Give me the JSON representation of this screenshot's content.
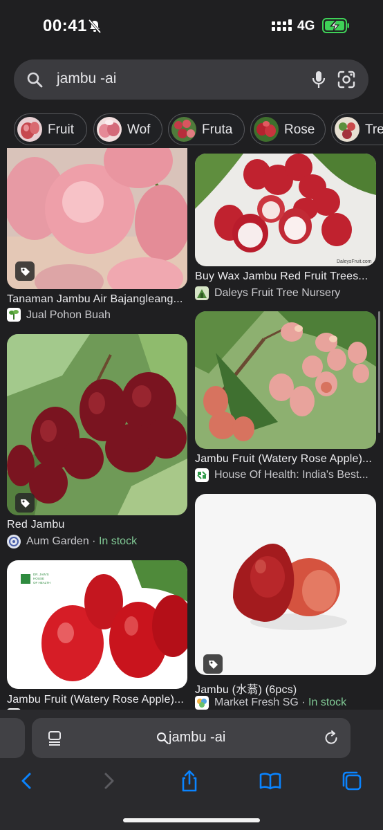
{
  "status": {
    "time": "00:41",
    "network": "4G",
    "battery_charging": true
  },
  "search": {
    "query": "jambu -ai"
  },
  "chips": [
    {
      "label": "Fruit"
    },
    {
      "label": "Wof"
    },
    {
      "label": "Fruta"
    },
    {
      "label": "Rose"
    },
    {
      "label": "Tre"
    }
  ],
  "results": [
    {
      "title": "Tanaman Jambu Air Bajangleang...",
      "source": "Jual Pohon Buah",
      "stock": ""
    },
    {
      "title": "Buy Wax Jambu Red Fruit Trees...",
      "source": "Daleys Fruit Tree Nursery",
      "stock": "",
      "watermark": "DaleysFruit.com"
    },
    {
      "title": "Jambu Fruit (Watery Rose Apple)...",
      "source": "House Of Health: India's Best...",
      "stock": ""
    },
    {
      "title": "Red Jambu",
      "source": "Aum Garden",
      "stock": "In stock"
    },
    {
      "title": "Jambu (水蓊) (6pcs)",
      "source": "Market Fresh SG",
      "stock": "In stock"
    },
    {
      "title": "Jambu Fruit (Watery Rose Apple)...",
      "source": "",
      "stock": "",
      "logo_text_1": "DR. JAIN'S",
      "logo_text_2": "HOUSE",
      "logo_text_3": "OF HEALTH"
    }
  ],
  "browser": {
    "url": "jambu -ai"
  },
  "colors": {
    "background": "#1f1f21",
    "in_stock": "#81c995",
    "accent": "#0a84ff"
  }
}
